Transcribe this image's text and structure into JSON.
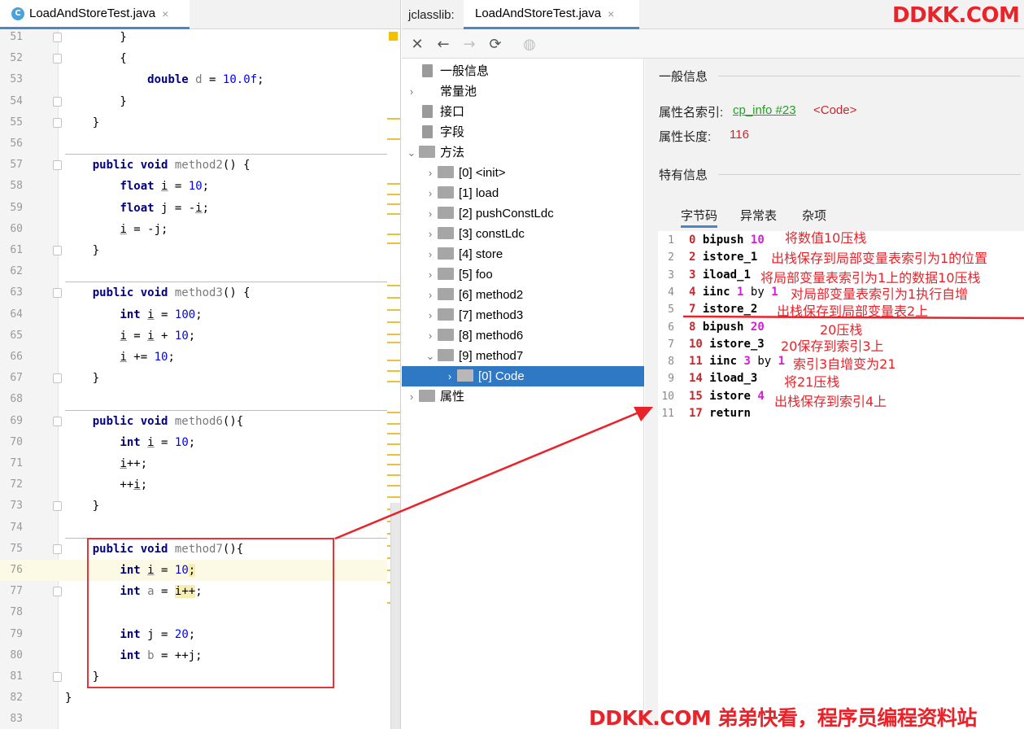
{
  "editor": {
    "tab": {
      "icon_letter": "C",
      "title": "LoadAndStoreTest.java",
      "close": "×"
    },
    "lines": [
      {
        "n": "51",
        "code": [
          [
            "",
            "        }"
          ]
        ]
      },
      {
        "n": "52",
        "code": [
          [
            "",
            "        {"
          ]
        ]
      },
      {
        "n": "53",
        "code": [
          [
            "",
            "            "
          ],
          [
            "kw",
            "double"
          ],
          [
            "",
            " "
          ],
          [
            "varg",
            "d"
          ],
          [
            "",
            " = "
          ],
          [
            "num",
            "10.0f"
          ],
          [
            "",
            ";"
          ]
        ]
      },
      {
        "n": "54",
        "code": [
          [
            "",
            "        }"
          ]
        ]
      },
      {
        "n": "55",
        "code": [
          [
            "",
            "    }"
          ]
        ]
      },
      {
        "n": "56",
        "code": []
      },
      {
        "n": "57",
        "code": [
          [
            "",
            "    "
          ],
          [
            "kw",
            "public void"
          ],
          [
            "",
            " "
          ],
          [
            "fn",
            "method2"
          ],
          [
            "",
            "() {"
          ]
        ]
      },
      {
        "n": "58",
        "code": [
          [
            "",
            "        "
          ],
          [
            "kw",
            "float"
          ],
          [
            "",
            " "
          ],
          [
            "var",
            "i"
          ],
          [
            "",
            " = "
          ],
          [
            "num",
            "10"
          ],
          [
            "",
            ";"
          ]
        ]
      },
      {
        "n": "59",
        "code": [
          [
            "",
            "        "
          ],
          [
            "kw",
            "float"
          ],
          [
            "",
            " j = -"
          ],
          [
            "var",
            "i"
          ],
          [
            "",
            ";"
          ]
        ]
      },
      {
        "n": "60",
        "code": [
          [
            "",
            "        "
          ],
          [
            "var",
            "i"
          ],
          [
            "",
            " = -j;"
          ]
        ]
      },
      {
        "n": "61",
        "code": [
          [
            "",
            "    }"
          ]
        ]
      },
      {
        "n": "62",
        "code": []
      },
      {
        "n": "63",
        "code": [
          [
            "",
            "    "
          ],
          [
            "kw",
            "public void"
          ],
          [
            "",
            " "
          ],
          [
            "fn",
            "method3"
          ],
          [
            "",
            "() {"
          ]
        ]
      },
      {
        "n": "64",
        "code": [
          [
            "",
            "        "
          ],
          [
            "kw",
            "int"
          ],
          [
            "",
            " "
          ],
          [
            "var",
            "i"
          ],
          [
            "",
            " = "
          ],
          [
            "num",
            "100"
          ],
          [
            "",
            ";"
          ]
        ]
      },
      {
        "n": "65",
        "code": [
          [
            "",
            "        "
          ],
          [
            "var",
            "i"
          ],
          [
            "",
            " = "
          ],
          [
            "var",
            "i"
          ],
          [
            "",
            " + "
          ],
          [
            "num",
            "10"
          ],
          [
            "",
            ";"
          ]
        ]
      },
      {
        "n": "66",
        "code": [
          [
            "",
            "        "
          ],
          [
            "var",
            "i"
          ],
          [
            "",
            " += "
          ],
          [
            "num",
            "10"
          ],
          [
            "",
            ";"
          ]
        ]
      },
      {
        "n": "67",
        "code": [
          [
            "",
            "    }"
          ]
        ]
      },
      {
        "n": "68",
        "code": []
      },
      {
        "n": "69",
        "code": [
          [
            "",
            "    "
          ],
          [
            "kw",
            "public void"
          ],
          [
            "",
            " "
          ],
          [
            "fn",
            "method6"
          ],
          [
            "",
            "(){"
          ]
        ]
      },
      {
        "n": "70",
        "code": [
          [
            "",
            "        "
          ],
          [
            "kw",
            "int"
          ],
          [
            "",
            " "
          ],
          [
            "var",
            "i"
          ],
          [
            "",
            " = "
          ],
          [
            "num",
            "10"
          ],
          [
            "",
            ";"
          ]
        ]
      },
      {
        "n": "71",
        "code": [
          [
            "",
            "        "
          ],
          [
            "var",
            "i"
          ],
          [
            "",
            "++;"
          ]
        ]
      },
      {
        "n": "72",
        "code": [
          [
            "",
            "        ++"
          ],
          [
            "var",
            "i"
          ],
          [
            "",
            ";"
          ]
        ]
      },
      {
        "n": "73",
        "code": [
          [
            "",
            "    }"
          ]
        ]
      },
      {
        "n": "74",
        "code": []
      },
      {
        "n": "75",
        "code": [
          [
            "",
            "    "
          ],
          [
            "kw",
            "public void"
          ],
          [
            "",
            " "
          ],
          [
            "fn",
            "method7"
          ],
          [
            "",
            "(){"
          ]
        ]
      },
      {
        "n": "76",
        "code": [
          [
            "",
            "        "
          ],
          [
            "kw",
            "int"
          ],
          [
            "",
            " "
          ],
          [
            "var",
            "i"
          ],
          [
            "",
            " = "
          ],
          [
            "num",
            "10"
          ],
          [
            "hl",
            ";"
          ]
        ]
      },
      {
        "n": "77",
        "code": [
          [
            "",
            "        "
          ],
          [
            "kw",
            "int"
          ],
          [
            "",
            " "
          ],
          [
            "varg",
            "a"
          ],
          [
            "",
            " = "
          ],
          [
            "hl",
            "i++"
          ],
          [
            "",
            ";"
          ]
        ]
      },
      {
        "n": "78",
        "code": []
      },
      {
        "n": "79",
        "code": [
          [
            "",
            "        "
          ],
          [
            "kw",
            "int"
          ],
          [
            "",
            " j = "
          ],
          [
            "num",
            "20"
          ],
          [
            "",
            ";"
          ]
        ]
      },
      {
        "n": "80",
        "code": [
          [
            "",
            "        "
          ],
          [
            "kw",
            "int"
          ],
          [
            "",
            " "
          ],
          [
            "varg",
            "b"
          ],
          [
            "",
            " = ++j;"
          ]
        ]
      },
      {
        "n": "81",
        "code": [
          [
            "",
            "    }"
          ]
        ]
      },
      {
        "n": "82",
        "code": [
          [
            "",
            "}"
          ]
        ]
      },
      {
        "n": "83",
        "code": []
      }
    ]
  },
  "jclasslib": {
    "label": "jclasslib:",
    "tab": {
      "title": "LoadAndStoreTest.java",
      "close": "×"
    },
    "toolbar": {
      "close_icon": "✕",
      "back_icon": "←",
      "forward_icon": "→",
      "refresh_icon": "⟳",
      "web_icon": "◍"
    },
    "tree": [
      {
        "label": "一般信息",
        "indent": 0,
        "arrow": "",
        "icon": "page"
      },
      {
        "label": "常量池",
        "indent": 0,
        "arrow": "›",
        "icon": "none"
      },
      {
        "label": "接口",
        "indent": 0,
        "arrow": "",
        "icon": "page"
      },
      {
        "label": "字段",
        "indent": 0,
        "arrow": "",
        "icon": "page"
      },
      {
        "label": "方法",
        "indent": 0,
        "arrow": "⌄",
        "icon": "folder"
      },
      {
        "label": "[0] <init>",
        "indent": 1,
        "arrow": "›",
        "icon": "folder"
      },
      {
        "label": "[1] load",
        "indent": 1,
        "arrow": "›",
        "icon": "folder"
      },
      {
        "label": "[2] pushConstLdc",
        "indent": 1,
        "arrow": "›",
        "icon": "folder"
      },
      {
        "label": "[3] constLdc",
        "indent": 1,
        "arrow": "›",
        "icon": "folder"
      },
      {
        "label": "[4] store",
        "indent": 1,
        "arrow": "›",
        "icon": "folder"
      },
      {
        "label": "[5] foo",
        "indent": 1,
        "arrow": "›",
        "icon": "folder"
      },
      {
        "label": "[6] method2",
        "indent": 1,
        "arrow": "›",
        "icon": "folder"
      },
      {
        "label": "[7] method3",
        "indent": 1,
        "arrow": "›",
        "icon": "folder"
      },
      {
        "label": "[8] method6",
        "indent": 1,
        "arrow": "›",
        "icon": "folder"
      },
      {
        "label": "[9] method7",
        "indent": 1,
        "arrow": "⌄",
        "icon": "folder"
      },
      {
        "label": "[0] Code",
        "indent": 2,
        "arrow": "›",
        "icon": "folder",
        "selected": true
      },
      {
        "label": "属性",
        "indent": 0,
        "arrow": "›",
        "icon": "folder"
      }
    ],
    "detail": {
      "general_title": "一般信息",
      "attr_name_label": "属性名索引:",
      "attr_name_link": "cp_info #23",
      "attr_name_value": "<Code>",
      "attr_len_label": "属性长度:",
      "attr_len_value": "116",
      "specific_title": "特有信息",
      "subtabs": [
        "字节码",
        "异常表",
        "杂项"
      ],
      "bytecode": [
        {
          "ln": "1",
          "off": "0",
          "op": "bipush",
          "arg": "10",
          "by": "",
          "arg2": ""
        },
        {
          "ln": "2",
          "off": "2",
          "op": "istore_1",
          "arg": "",
          "by": "",
          "arg2": ""
        },
        {
          "ln": "3",
          "off": "3",
          "op": "iload_1",
          "arg": "",
          "by": "",
          "arg2": ""
        },
        {
          "ln": "4",
          "off": "4",
          "op": "iinc",
          "arg": "1",
          "by": "by",
          "arg2": "1"
        },
        {
          "ln": "5",
          "off": "7",
          "op": "istore_2",
          "arg": "",
          "by": "",
          "arg2": ""
        },
        {
          "ln": "6",
          "off": "8",
          "op": "bipush",
          "arg": "20",
          "by": "",
          "arg2": ""
        },
        {
          "ln": "7",
          "off": "10",
          "op": "istore_3",
          "arg": "",
          "by": "",
          "arg2": ""
        },
        {
          "ln": "8",
          "off": "11",
          "op": "iinc",
          "arg": "3",
          "by": "by",
          "arg2": "1"
        },
        {
          "ln": "9",
          "off": "14",
          "op": "iload_3",
          "arg": "",
          "by": "",
          "arg2": ""
        },
        {
          "ln": "10",
          "off": "15",
          "op": "istore",
          "arg": "4",
          "by": "",
          "arg2": ""
        },
        {
          "ln": "11",
          "off": "17",
          "op": "return",
          "arg": "",
          "by": "",
          "arg2": ""
        }
      ],
      "annotations": [
        "将数值10压栈",
        "出栈保存到局部变量表索引为1的位置",
        "将局部变量表索引为1上的数据10压栈",
        "对局部变量表索引为1执行自增",
        "出栈保存到局部变量表2上",
        "20压栈",
        "20保存到索引3上",
        "索引3自增变为21",
        "将21压栈",
        "出栈保存到索引4上"
      ]
    }
  },
  "watermarks": {
    "top": "DDKK.COM",
    "bottom": "DDKK.COM 弟弟快看，程序员编程资料站"
  },
  "colors": {
    "annotation_red": "#e8232a",
    "selection_blue": "#2f78c4",
    "link_green": "#2a9c2a",
    "arg_magenta": "#d81bd8"
  }
}
